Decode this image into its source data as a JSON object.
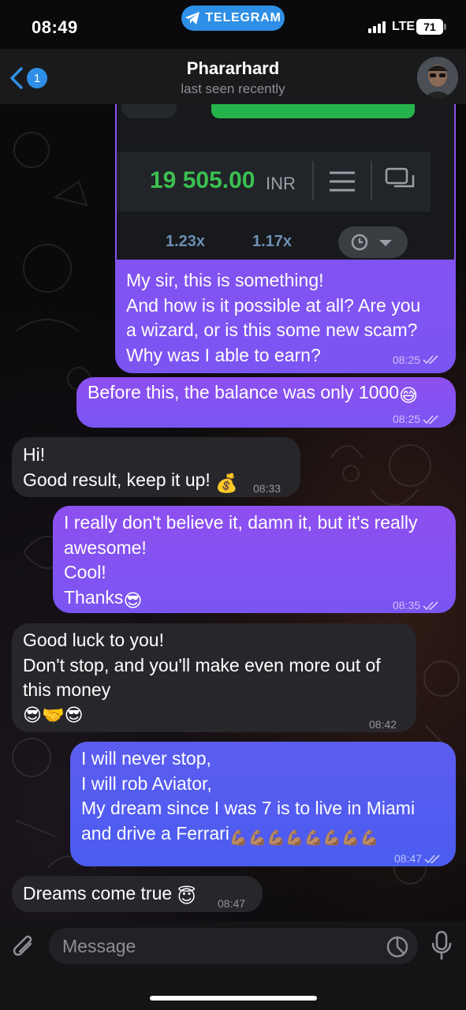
{
  "status_bar": {
    "time": "08:49",
    "app_pill": "TELEGRAM",
    "network": "LTE",
    "battery": "71"
  },
  "header": {
    "back_count": "1",
    "name": "Phararhard",
    "status": "last seen recently"
  },
  "image_preview": {
    "balance": "19 505.00",
    "currency": "INR",
    "multipliers": [
      "1.23x",
      "1.17x"
    ]
  },
  "messages": [
    {
      "dir": "out",
      "lines": [
        "My sir, this is something!",
        "And how is it possible at all? Are you",
        "a wizard, or is this some new scam?",
        "Why was I able to earn?"
      ],
      "time": "08:25"
    },
    {
      "dir": "out",
      "lines": [
        "Before this, the balance was only 1000"
      ],
      "emoji": "😅",
      "time": "08:25"
    },
    {
      "dir": "in",
      "lines": [
        "Hi!",
        "Good result, keep it up!"
      ],
      "emoji": "💰",
      "time": "08:33"
    },
    {
      "dir": "out",
      "lines": [
        "I really don't believe it, damn it, but it's really",
        "awesome!",
        "Cool!",
        "Thanks"
      ],
      "emoji": "😎",
      "time": "08:35"
    },
    {
      "dir": "in",
      "lines": [
        "Good luck to you!",
        "Don't stop, and you'll make even more out of",
        "this money"
      ],
      "emoji_line": "😎🤝😎",
      "time": "08:42"
    },
    {
      "dir": "out",
      "lines": [
        "I will never stop,",
        "I will rob Aviator,",
        "My dream since I was 7 is to live in Miami",
        "and drive a Ferrari"
      ],
      "emoji": "💪🏽💪🏽💪🏽💪🏽💪🏽💪🏽💪🏽💪🏽",
      "time": "08:47"
    },
    {
      "dir": "in",
      "lines": [
        "Dreams come true "
      ],
      "emoji": "😇",
      "time": "08:47"
    }
  ],
  "input": {
    "placeholder": "Message"
  },
  "icons": {
    "attach": "paperclip-icon",
    "sticker": "sticker-icon",
    "mic": "microphone-icon",
    "back": "chevron-left-icon",
    "send_plane": "telegram-plane-icon"
  },
  "colors": {
    "outgoing": "#8a52f0",
    "incoming": "#27262b",
    "accent": "#2f8fe6",
    "balance_green": "#3cc051"
  }
}
